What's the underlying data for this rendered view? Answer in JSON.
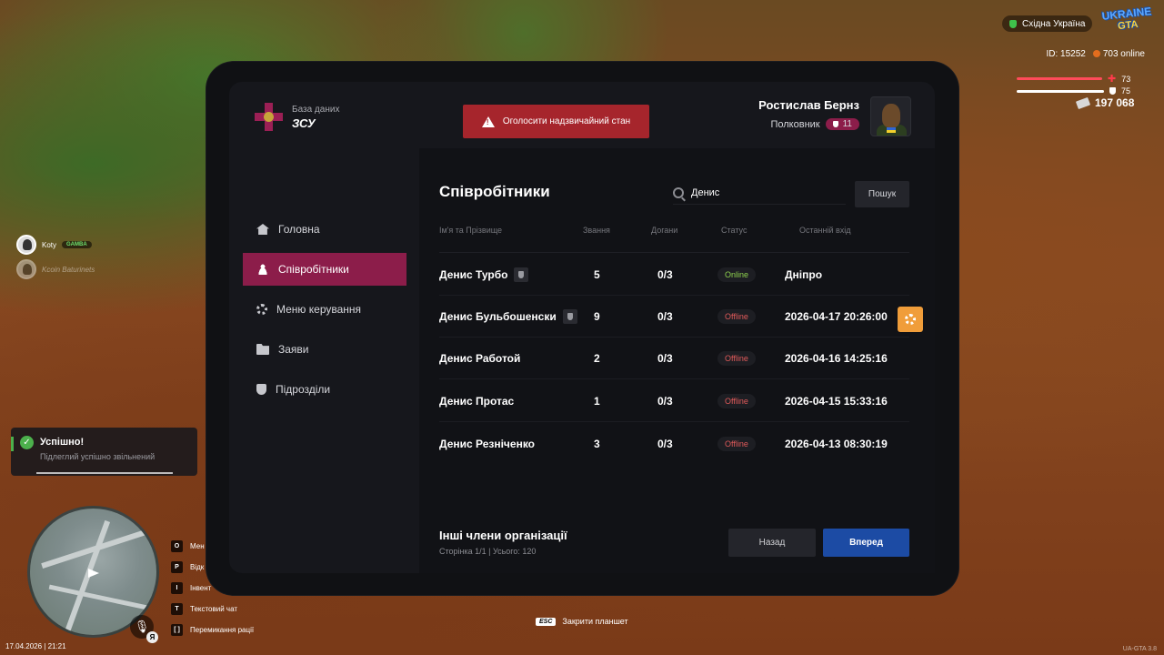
{
  "hud": {
    "region": "Східна Україна",
    "logo_line1": "UKRAINE",
    "logo_line2": "GTA",
    "player_id": "ID: 15252",
    "online": "703 online",
    "health": "73",
    "health_fraction": 0.73,
    "armor": "75",
    "armor_fraction": 0.75,
    "money": "197 068"
  },
  "friends": [
    {
      "name": "Koty",
      "tag": "GAMBA"
    },
    {
      "name": "Kcoin Baturinets"
    }
  ],
  "notification": {
    "title": "Успішно!",
    "text": "Підлеглий успішно звільнений"
  },
  "bottom": {
    "datetime": "17.04.2026 | 21:21",
    "lang": "Я",
    "keys": [
      {
        "key": "O",
        "label": "Мен"
      },
      {
        "key": "P",
        "label": "Відк"
      },
      {
        "key": "I",
        "label": "Інвент"
      },
      {
        "key": "T",
        "label": "Текстовий чат"
      },
      {
        "key": "[ ]",
        "label": "Перемикання рації"
      }
    ],
    "esc_key": "ESC",
    "esc_label": "Закрити планшет",
    "version": "UA-GTA 3.8"
  },
  "tablet": {
    "brand_sub": "База даних",
    "brand_name": "ЗСУ",
    "alert_button": "Оголосити надзвичайний стан",
    "user_name": "Ростислав Бернз",
    "user_rank": "Полковник",
    "user_rank_level": "11",
    "nav": [
      {
        "label": "Головна",
        "icon": "home-icon"
      },
      {
        "label": "Співробітники",
        "icon": "people-icon",
        "active": true
      },
      {
        "label": "Меню керування",
        "icon": "gear-icon"
      },
      {
        "label": "Заяви",
        "icon": "folder-icon"
      },
      {
        "label": "Підрозділи",
        "icon": "shield-icon"
      }
    ],
    "page_title": "Співробітники",
    "search_value": "Денис",
    "search_button": "Пошук",
    "columns": [
      "Ім'я та Прізвище",
      "Звання",
      "Догани",
      "Статус",
      "Останній вхід"
    ],
    "rows": [
      {
        "name": "Денис Турбо",
        "badge": true,
        "rank": "5",
        "reprimands": "0/3",
        "status": "Online",
        "last": "Дніпро"
      },
      {
        "name": "Денис Бульбошенски",
        "badge": true,
        "rank": "9",
        "reprimands": "0/3",
        "status": "Offline",
        "last": "2026-04-17 20:26:00"
      },
      {
        "name": "Денис Работой",
        "badge": false,
        "rank": "2",
        "reprimands": "0/3",
        "status": "Offline",
        "last": "2026-04-16 14:25:16"
      },
      {
        "name": "Денис Протас",
        "badge": false,
        "rank": "1",
        "reprimands": "0/3",
        "status": "Offline",
        "last": "2026-04-15 15:33:16"
      },
      {
        "name": "Денис Резніченко",
        "badge": false,
        "rank": "3",
        "reprimands": "0/3",
        "status": "Offline",
        "last": "2026-04-13 08:30:19"
      }
    ],
    "others_title": "Інші члени організації",
    "others_sub": "Сторінка 1/1 | Усього: 120",
    "back_button": "Назад",
    "next_button": "Вперед"
  },
  "colors": {
    "accent": "#8c1d4a",
    "danger": "#a6252c",
    "primary": "#1c4ba4",
    "online": "#8ed14e",
    "offline": "#e05a5a",
    "warning": "#f09d3a"
  }
}
